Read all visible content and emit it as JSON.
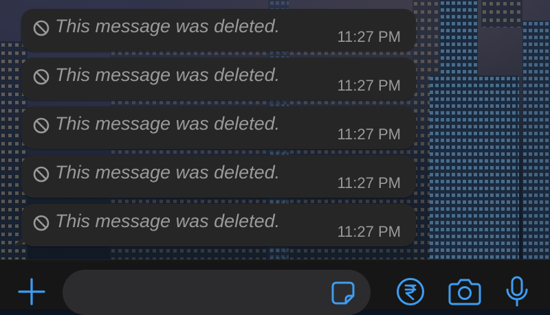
{
  "messages": [
    {
      "text": "This message was deleted.",
      "time": "11:27 PM"
    },
    {
      "text": "This message was deleted.",
      "time": "11:27 PM"
    },
    {
      "text": "This message was deleted.",
      "time": "11:27 PM"
    },
    {
      "text": "This message was deleted.",
      "time": "11:27 PM"
    },
    {
      "text": "This message was deleted.",
      "time": "11:27 PM"
    }
  ],
  "composer": {
    "input_value": "",
    "icons": [
      "plus-icon",
      "sticker-icon",
      "rupee-payment-icon",
      "camera-icon",
      "microphone-icon"
    ]
  },
  "colors": {
    "bubble": "#262626",
    "text_muted": "#9a9a9a",
    "accent": "#3d9df3",
    "composer_bg": "#161616"
  }
}
